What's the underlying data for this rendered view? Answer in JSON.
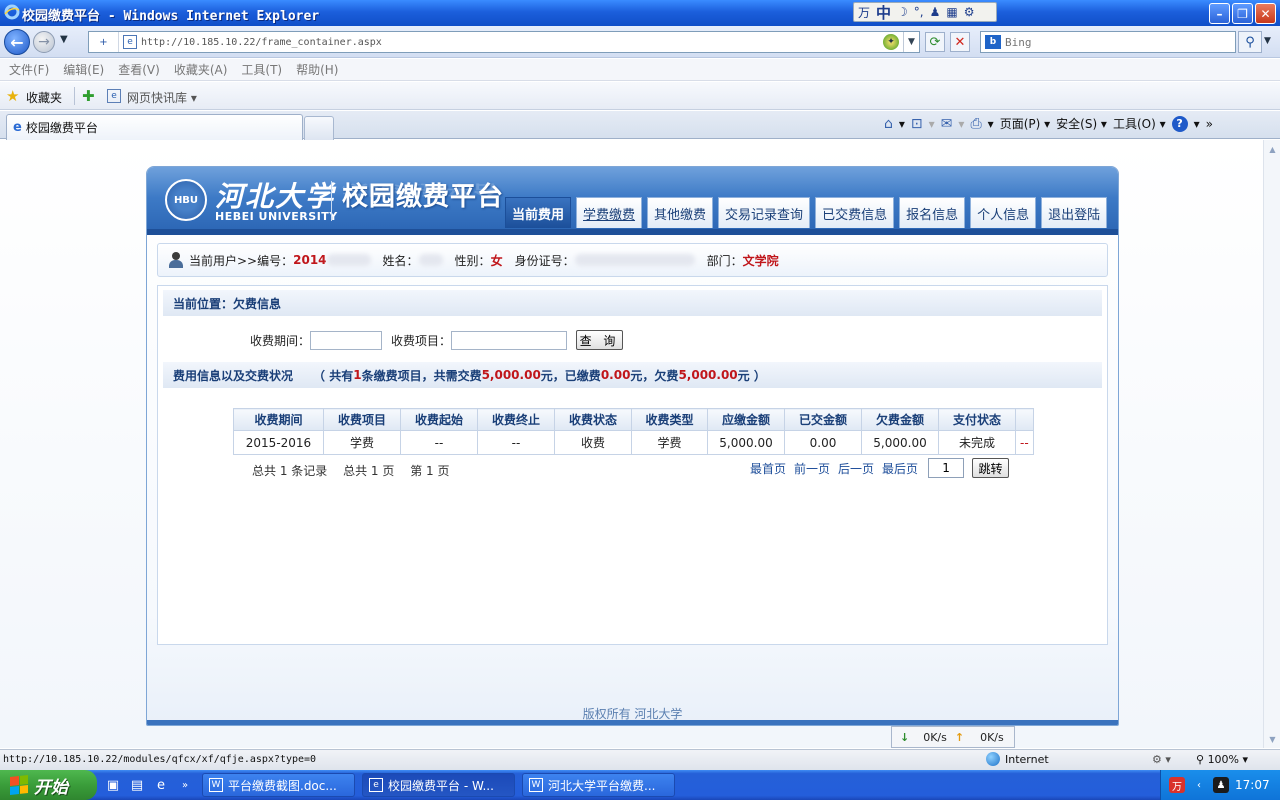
{
  "browser": {
    "window_title": "校园缴费平台 - Windows Internet Explorer",
    "ime": {
      "label": "中",
      "extra": "°,"
    },
    "address": {
      "tag": "+",
      "url": "http://10.185.10.22/frame_container.aspx"
    },
    "search": {
      "provider": "b",
      "placeholder": "Bing"
    },
    "menu": [
      "文件(F)",
      "编辑(E)",
      "查看(V)",
      "收藏夹(A)",
      "工具(T)",
      "帮助(H)"
    ],
    "favorites": {
      "label": "收藏夹",
      "web_slice": "网页快讯库 ▾"
    },
    "tab": {
      "label": "校园缴费平台"
    },
    "commands": {
      "page": "页面(P) ▾",
      "safety": "安全(S) ▾",
      "tools": "工具(O) ▾"
    },
    "status": {
      "url": "http://10.185.10.22/modules/qfcx/xf/qfje.aspx?type=0",
      "zone": "Internet",
      "zoom": "100%",
      "download_speed": "0K/s",
      "upload_speed": "0K/s"
    }
  },
  "portal": {
    "university_cn": "河北大学",
    "university_en": "HEBEI UNIVERSITY",
    "platform_title": "校园缴费平台",
    "nav": [
      {
        "label": "当前费用",
        "active": true
      },
      {
        "label": "学费缴费",
        "active": false
      },
      {
        "label": "其他缴费",
        "active": false
      },
      {
        "label": "交易记录查询",
        "active": false
      },
      {
        "label": "已交费信息",
        "active": false
      },
      {
        "label": "报名信息",
        "active": false
      },
      {
        "label": "个人信息",
        "active": false
      },
      {
        "label": "退出登陆",
        "active": false
      }
    ],
    "user": {
      "prefix": "当前用户>>编号：",
      "id_value": "2014",
      "name_label": "姓名：",
      "gender_label": "性别：",
      "gender_value": "女",
      "idcard_label": "身份证号：",
      "dept_label": "部门：",
      "dept_value": "文学院"
    },
    "breadcrumb": "当前位置：欠费信息",
    "filters": {
      "period_label": "收费期间：",
      "item_label": "收费项目：",
      "query_button": "查 询"
    },
    "summary": {
      "title": "费用信息以及交费状况",
      "open": "（ 共有",
      "count": "1",
      "text1": "条缴费项目，共需交费",
      "total": "5,000.00",
      "text2": "元，已缴费",
      "paid": "0.00",
      "text3": "元，欠费",
      "owed": "5,000.00",
      "text4": "元 ）"
    },
    "table": {
      "headers": [
        "收费期间",
        "收费项目",
        "收费起始",
        "收费终止",
        "收费状态",
        "收费类型",
        "应缴金额",
        "已交金额",
        "欠费金额",
        "支付状态"
      ],
      "rows": [
        [
          "2015-2016",
          "学费",
          "--",
          "--",
          "收费",
          "学费",
          "5,000.00",
          "0.00",
          "5,000.00",
          "未完成",
          "--"
        ]
      ]
    },
    "pager": {
      "total_records": "总共 1 条记录",
      "total_pages": "总共 1 页",
      "current_page": "第 1 页",
      "first": "最首页",
      "prev": "前一页",
      "next": "后一页",
      "last": "最后页",
      "page_input": "1",
      "jump_button": "跳转"
    },
    "copyright": "版权所有 河北大学"
  },
  "taskbar": {
    "start": "开始",
    "tasks": [
      "平台缴费截图.doc...",
      "校园缴费平台 - W...",
      "河北大学平台缴费..."
    ],
    "clock": "17:07"
  }
}
